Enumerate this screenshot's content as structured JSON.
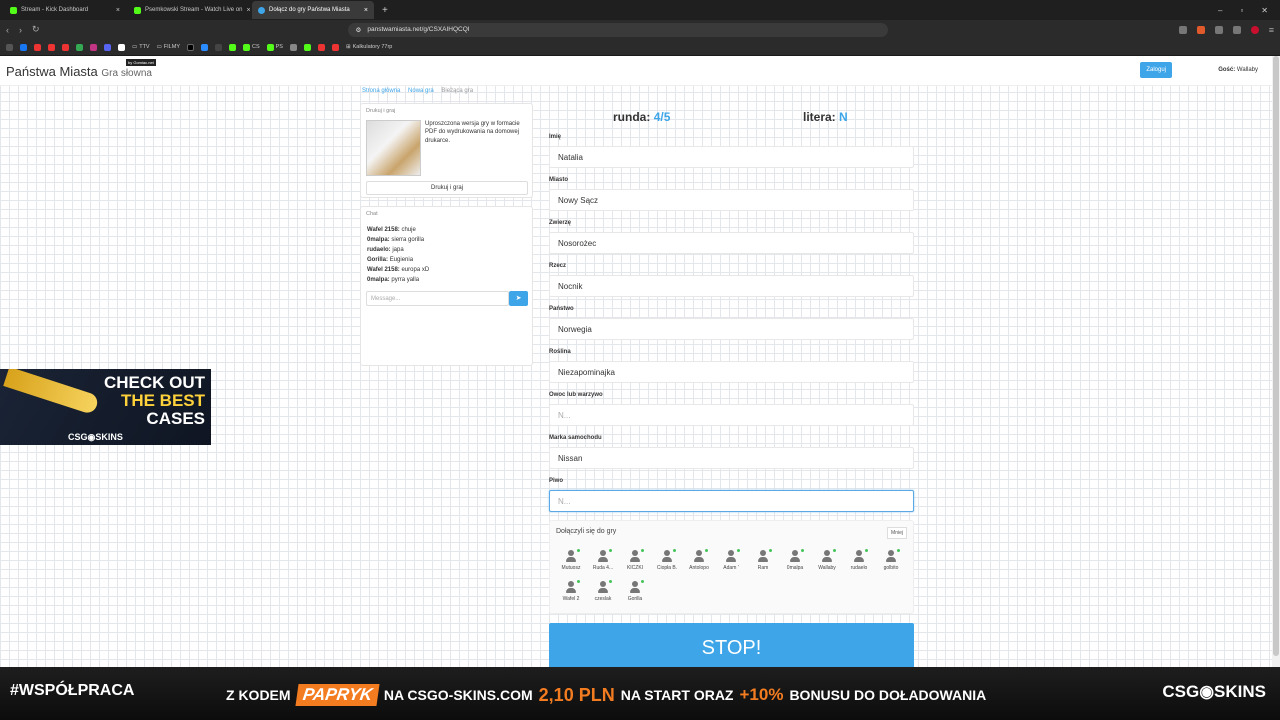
{
  "browser": {
    "tabs": [
      {
        "title": "Stream - Kick Dashboard",
        "color": "#53fc18"
      },
      {
        "title": "Psemkowski Stream - Watch Live on",
        "color": "#53fc18"
      },
      {
        "title": "Dołącz do gry Państwa Miasta",
        "color": "#3ea5e8",
        "active": true
      }
    ],
    "url": "panstwamiasta.net/g/CSXAIHQCQI",
    "bookmarks": [
      "TTV",
      "FILMY",
      "CS",
      "PS",
      "Kalkulatory 77rp"
    ]
  },
  "site": {
    "title": "Państwa Miasta",
    "subtitle": "Gra słowna",
    "badge": "by Gomiac.net",
    "login_label": "Zaloguj",
    "guest_label": "Gość:",
    "guest_name": "Wallaby"
  },
  "breadcrumbs": [
    "Strona główna",
    "Nowa gra",
    "Bieżąca gra"
  ],
  "print_card": {
    "header": "Drukuj i graj",
    "text": "Uproszczona wersja gry w formacie PDF do wydrukowania na domowej drukarce.",
    "button": "Drukuj i graj"
  },
  "chat": {
    "header": "Chat",
    "messages": [
      {
        "user": "Wafel 2158:",
        "text": "chuje"
      },
      {
        "user": "0malpa:",
        "text": "sierra gorilla"
      },
      {
        "user": "rudaelo:",
        "text": "japa"
      },
      {
        "user": "Gorilla:",
        "text": "Eugienia"
      },
      {
        "user": "Wafel 2158:",
        "text": "europa xD"
      },
      {
        "user": "0malpa:",
        "text": "pyrra yalla"
      }
    ],
    "placeholder": "Message..."
  },
  "game": {
    "round_label": "runda:",
    "round_value": "4/5",
    "letter_label": "litera:",
    "letter_value": "N",
    "fields": [
      {
        "label": "Imię",
        "value": "Natalia",
        "placeholder": ""
      },
      {
        "label": "Miasto",
        "value": "Nowy Sącz",
        "placeholder": ""
      },
      {
        "label": "Zwierzę",
        "value": "Nosorożec",
        "placeholder": ""
      },
      {
        "label": "Rzecz",
        "value": "Nocnik",
        "placeholder": ""
      },
      {
        "label": "Państwo",
        "value": "Norwegia",
        "placeholder": ""
      },
      {
        "label": "Roślina",
        "value": "Niezapominajka",
        "placeholder": ""
      },
      {
        "label": "Owoc lub warzywo",
        "value": "",
        "placeholder": "N..."
      },
      {
        "label": "Marka samochodu",
        "value": "Nissan",
        "placeholder": ""
      },
      {
        "label": "Piwo",
        "value": "",
        "placeholder": "N..."
      }
    ],
    "players_title": "Dołączyli się do gry",
    "players_less": "Mniej",
    "players": [
      "Mutuosz",
      "Ruda 4...",
      "KICZKI",
      "Ciopła B.",
      "Antolopo",
      "Adam '",
      "Ram",
      "0malpa",
      "Wallaby",
      "rudaelo",
      "golbito",
      "Wafel 2",
      "czeslak",
      "Gorilla"
    ],
    "stop_label": "STOP!"
  },
  "ads": {
    "left_line1": "CHECK OUT",
    "left_line2": "THE BEST",
    "left_line3": "CASES",
    "left_logo": "CSG◉SKINS",
    "banner_left": "#WSPÓŁPRACA",
    "banner_z": "Z KODEM",
    "banner_code": "PAPRYK",
    "banner_na": "NA CSGO-SKINS.COM",
    "banner_price": "2,10 PLN",
    "banner_start": "NA START ORAZ",
    "banner_pct": "+10%",
    "banner_bonus": "BONUSU DO DOŁADOWANIA",
    "banner_right": "CSG◉SKINS"
  }
}
